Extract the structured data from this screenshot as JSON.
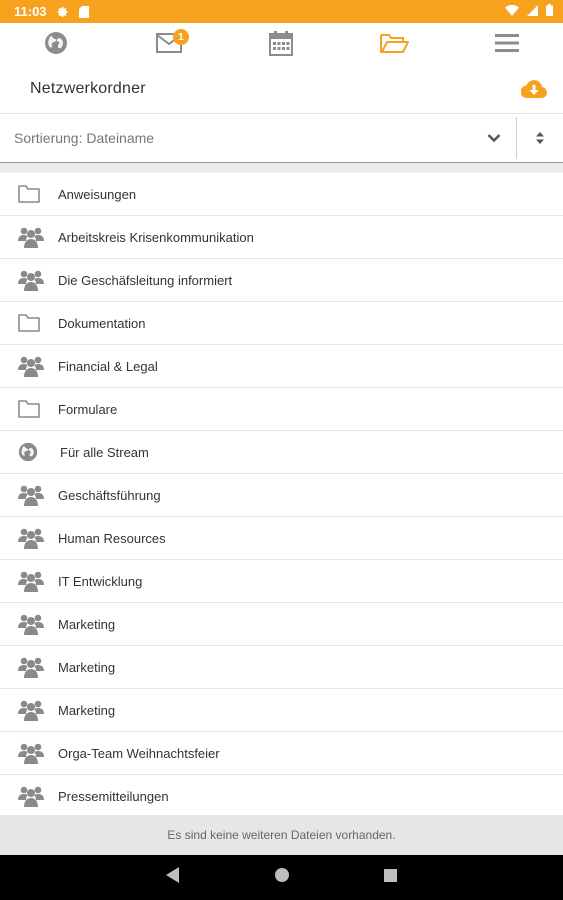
{
  "status": {
    "time": "11:03"
  },
  "nav": {
    "items": [
      {
        "icon": "globe-icon"
      },
      {
        "icon": "mail-icon",
        "badge": "1"
      },
      {
        "icon": "calendar-icon"
      },
      {
        "icon": "folder-open-icon",
        "active": true
      },
      {
        "icon": "menu-icon"
      }
    ],
    "accent": "#f6a21e",
    "inactive": "#8c8c8c"
  },
  "header": {
    "title": "Netzwerkordner"
  },
  "sort": {
    "label": "Sortierung: Dateiname"
  },
  "items": [
    {
      "type": "folder",
      "name": "Anweisungen"
    },
    {
      "type": "group",
      "name": "Arbeitskreis Krisenkommunikation"
    },
    {
      "type": "group",
      "name": "Die Geschäfsleitung informiert"
    },
    {
      "type": "folder",
      "name": "Dokumentation"
    },
    {
      "type": "group",
      "name": "Financial & Legal"
    },
    {
      "type": "folder",
      "name": "Formulare"
    },
    {
      "type": "globe",
      "name": "Für alle Stream"
    },
    {
      "type": "group",
      "name": "Geschäftsführung"
    },
    {
      "type": "group",
      "name": "Human Resources"
    },
    {
      "type": "group",
      "name": "IT Entwicklung"
    },
    {
      "type": "group",
      "name": "Marketing"
    },
    {
      "type": "group",
      "name": "Marketing"
    },
    {
      "type": "group",
      "name": "Marketing"
    },
    {
      "type": "group",
      "name": "Orga-Team Weihnachtsfeier"
    },
    {
      "type": "group",
      "name": "Pressemitteilungen"
    }
  ],
  "footer": {
    "message": "Es sind keine weiteren Dateien vorhanden."
  }
}
